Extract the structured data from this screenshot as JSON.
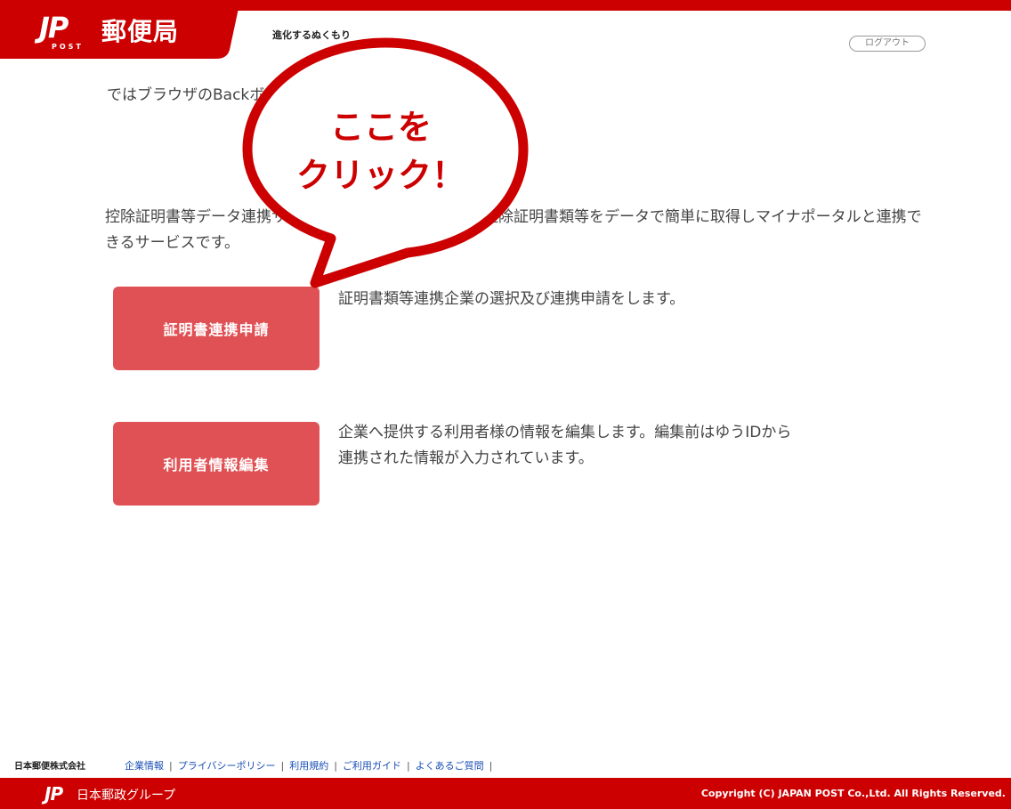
{
  "header": {
    "logo_mark": "JP",
    "logo_sub": "POST",
    "brand_name": "郵便局",
    "service_name": "進化するぬくもり",
    "logout_label": "ログアウト"
  },
  "main": {
    "notice": "ではブラウザのBackボタンは使用しないでください。",
    "intro": "控除証明書等データ連携サービスは、金融機関等発行の控除証明書類等をデータで簡単に取得しマイナポータルと連携できるサービスです。",
    "actions": [
      {
        "label": "証明書連携申請",
        "description": "証明書類等連携企業の選択及び連携申請をします。"
      },
      {
        "label": "利用者情報編集",
        "description": "企業へ提供する利用者様の情報を編集します。編集前はゆうIDから連携された情報が入力されています。"
      }
    ]
  },
  "callout": {
    "line1": "ここを",
    "line2": "クリック！"
  },
  "footer": {
    "company": "日本郵便株式会社",
    "links": [
      "企業情報",
      "プライバシーポリシー",
      "利用規約",
      "ご利用ガイド",
      "よくあるご質問"
    ],
    "group_mark": "JP",
    "group_name": "日本郵政グループ",
    "copyright": "Copyright (C) JAPAN POST Co.,Ltd.  All Rights Reserved."
  },
  "colors": {
    "brand_red": "#cc0000",
    "button_red": "#e05155",
    "link_blue": "#1a4fb5"
  }
}
